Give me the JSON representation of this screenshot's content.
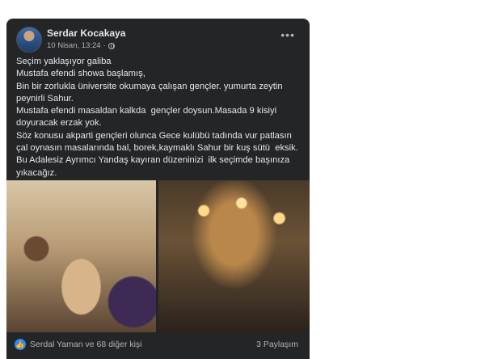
{
  "post": {
    "author": "Serdar Kocakaya",
    "date": "10 Nisan, 13:24",
    "privacy_icon": "globe-icon",
    "more_icon": "more-options-icon",
    "text_lines": [
      "Seçim yaklaşıyor galiba",
      "Mustafa efendi showa başlamış,",
      "Bin bir zorlukla üniversite okumaya çalışan gençler. yumurta zeytin peynirli Sahur.",
      "Mustafa efendi masaldan kalkda  gençler doysun.Masada 9 kisiyi doyuracak erzak yok.",
      "Söz konusu akparti gençleri olunca Gece kulübü tadında vur patlasın çal oynasın masalarında bal, borek,kaymaklı Sahur bir kuş sütü  eksik.",
      "Bu Adalesiz Ayrımcı Yandaş kayıran düzeninizi  ilk seçimde başınıza yıkacağız."
    ]
  },
  "footer": {
    "reaction_icon": "like-icon",
    "reactions_text": "Serdal Yaman ve 68 diğer kişi",
    "shares_text": "3 Paylaşım"
  },
  "colors": {
    "card_bg": "#242526",
    "text": "#e4e6eb",
    "secondary_text": "#b0b3b8",
    "like_blue": "#2d88ff"
  }
}
